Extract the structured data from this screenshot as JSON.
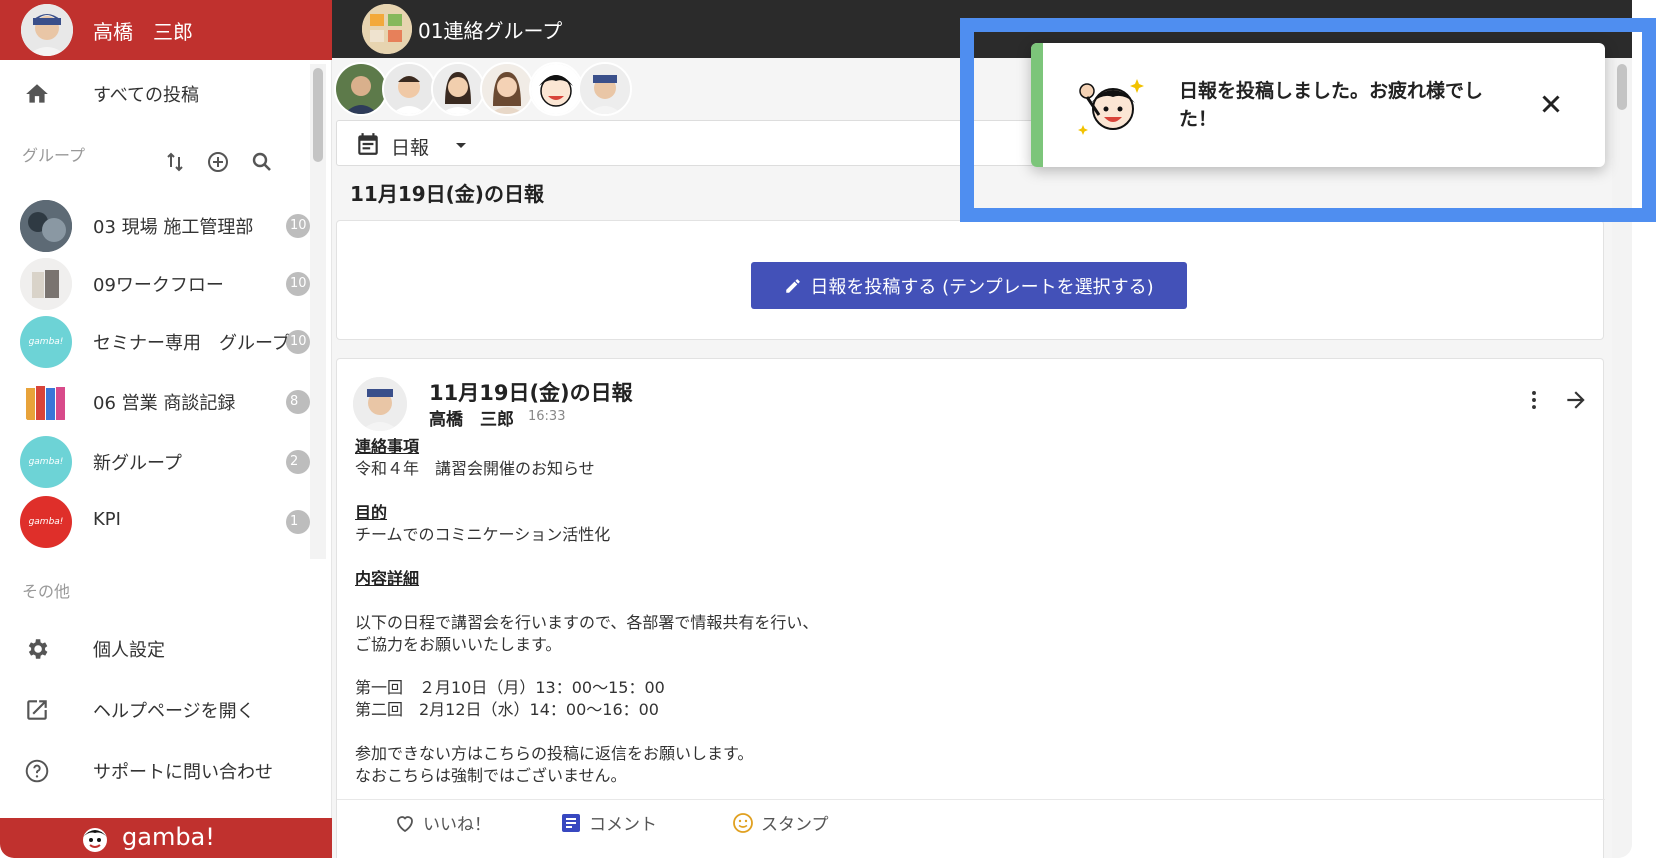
{
  "user": {
    "name": "高橋　三郎"
  },
  "sidebar": {
    "all_posts": "すべての投稿",
    "groups_header": "グループ",
    "groups": [
      {
        "name": "03 現場 施工管理部",
        "badge": "10",
        "avatar": "photo-dark"
      },
      {
        "name": "09ワークフロー",
        "badge": "10",
        "avatar": "books"
      },
      {
        "name": "セミナー専用　グループ",
        "badge": "10",
        "avatar": "gamba-teal"
      },
      {
        "name": "06 営業 商談記録",
        "badge": "8",
        "avatar": "binders"
      },
      {
        "name": "新グループ",
        "badge": "2",
        "avatar": "gamba-teal"
      },
      {
        "name": "KPI",
        "badge": "1",
        "avatar": "gamba-red"
      }
    ],
    "other_header": "その他",
    "other_items": [
      {
        "label": "個人設定",
        "icon": "gear-icon"
      },
      {
        "label": "ヘルプページを開く",
        "icon": "external-link-icon"
      },
      {
        "label": "サポートに問い合わせ",
        "icon": "help-circle-icon"
      }
    ],
    "brand": "gamba!",
    "avatar_text": "gamba!"
  },
  "topbar": {
    "group_title": "01連絡グループ"
  },
  "view_select": {
    "label": "日報"
  },
  "date_header": "11月19日(金)の日報",
  "compose_button": "日報を投稿する (テンプレートを選択する)",
  "post": {
    "title": "11月19日(金)の日報",
    "author": "高橋　三郎",
    "time": "16:33",
    "sections": [
      {
        "text": "連絡事項",
        "heading": true
      },
      {
        "text": "令和４年　講習会開催のお知らせ",
        "heading": false
      },
      {
        "text": "目的",
        "heading": true
      },
      {
        "text": "チームでのコミニケーション活性化",
        "heading": false
      },
      {
        "text": "内容詳細",
        "heading": true
      },
      {
        "text": "以下の日程で講習会を行いますので、各部署で情報共有を行い、",
        "heading": false
      },
      {
        "text": "ご協力をお願いいたします。",
        "heading": false
      },
      {
        "text": "第一回　２月10日（月）13：00〜15：00",
        "heading": false
      },
      {
        "text": "第二回　2月12日（水）14：00〜16：00",
        "heading": false
      },
      {
        "text": "参加できない方はこちらの投稿に返信をお願いします。",
        "heading": false
      },
      {
        "text": "なおこちらは強制ではございません。",
        "heading": false
      }
    ],
    "actions": {
      "like": "いいね！",
      "comment": "コメント",
      "stamp": "スタンプ"
    }
  },
  "toast": {
    "message": "日報を投稿しました。お疲れ様でした！"
  },
  "colors": {
    "brand_red": "#c0312e",
    "topbar": "#2b2b2b",
    "primary_button": "#4351b8",
    "toast_accent": "#7cc57a",
    "highlight": "#4f8ef0"
  }
}
